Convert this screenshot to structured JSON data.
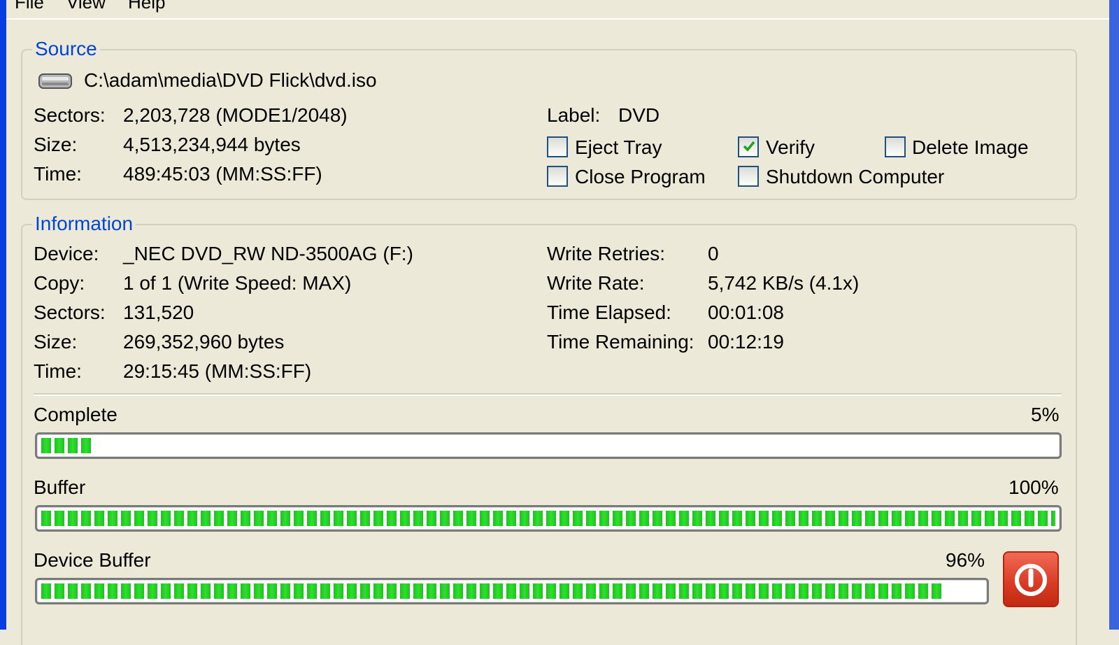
{
  "menu": {
    "items": [
      "File",
      "View",
      "Help"
    ]
  },
  "source": {
    "title": "Source",
    "path": "C:\\adam\\media\\DVD Flick\\dvd.iso",
    "rows": [
      {
        "label": "Sectors:",
        "value": "2,203,728 (MODE1/2048)"
      },
      {
        "label": "Size:",
        "value": "4,513,234,944 bytes"
      },
      {
        "label": "Time:",
        "value": "489:45:03 (MM:SS:FF)"
      }
    ],
    "label_key": "Label:",
    "label_value": "DVD",
    "options": [
      {
        "label": "Eject Tray",
        "checked": false
      },
      {
        "label": "Verify",
        "checked": true
      },
      {
        "label": "Delete Image",
        "checked": false
      },
      {
        "label": "Close Program",
        "checked": false
      },
      {
        "label": "Shutdown Computer",
        "checked": false
      }
    ]
  },
  "information": {
    "title": "Information",
    "left_rows": [
      {
        "label": "Device:",
        "value": "_NEC DVD_RW ND-3500AG (F:)"
      },
      {
        "label": "Copy:",
        "value": "1 of 1 (Write Speed: MAX)"
      },
      {
        "label": "Sectors:",
        "value": "131,520"
      },
      {
        "label": "Size:",
        "value": "269,352,960 bytes"
      },
      {
        "label": "Time:",
        "value": "29:15:45 (MM:SS:FF)"
      }
    ],
    "right_rows": [
      {
        "label": "Write Retries:",
        "value": "0"
      },
      {
        "label": "Write Rate:",
        "value": "5,742 KB/s (4.1x)"
      },
      {
        "label": "Time Elapsed:",
        "value": "00:01:08"
      },
      {
        "label": "Time Remaining:",
        "value": "00:12:19"
      }
    ]
  },
  "progress": {
    "complete": {
      "label": "Complete",
      "percent_text": "5%",
      "value": 0.05
    },
    "buffer": {
      "label": "Buffer",
      "percent_text": "100%",
      "value": 1.0
    },
    "device_buffer": {
      "label": "Device Buffer",
      "percent_text": "96%",
      "value": 0.96
    }
  },
  "colors": {
    "accent_title": "#0046d5",
    "progress_green": "#2ee02e",
    "stop_button": "#d83a22",
    "window_border": "#0a3ce6"
  },
  "icons": {
    "drive": "drive-icon",
    "check": "checkmark-icon",
    "stop": "power-stop-icon"
  }
}
